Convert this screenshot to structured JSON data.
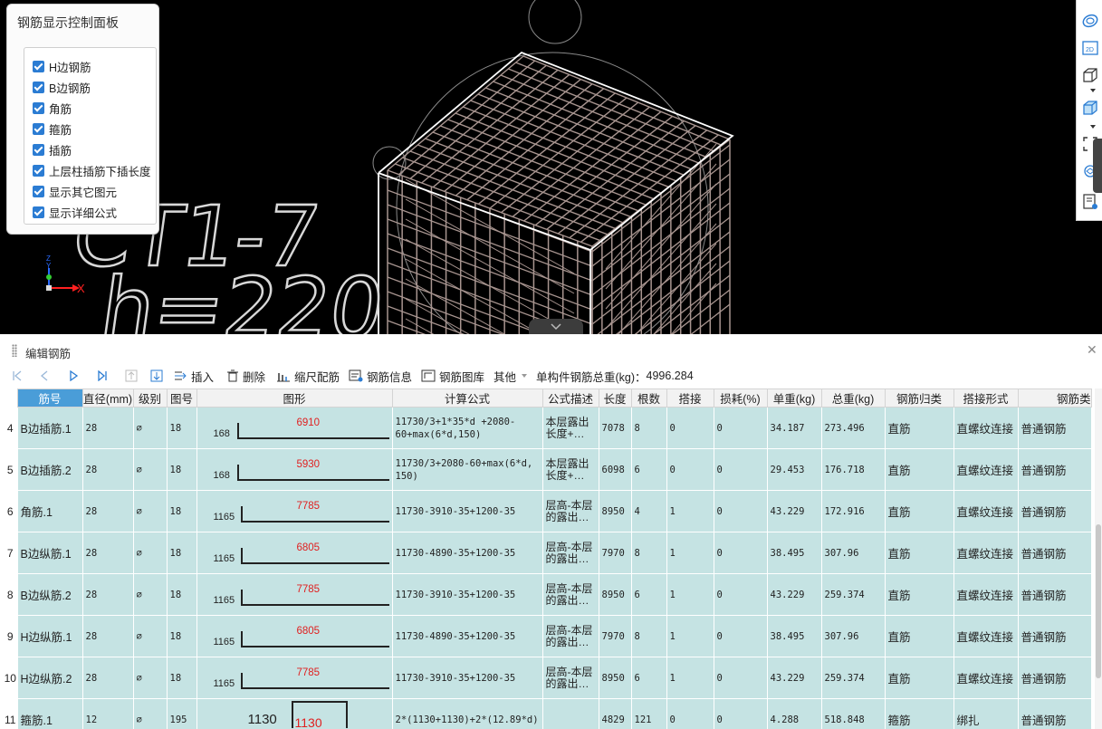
{
  "viewport": {
    "annotation_line1": "CT1-7",
    "annotation_line2": "h=220",
    "axis_x": "X",
    "axis_y": "Y",
    "axis_z": "Z"
  },
  "control_panel": {
    "title": "钢筋显示控制面板",
    "options": [
      {
        "label": "H边钢筋",
        "checked": true
      },
      {
        "label": "B边钢筋",
        "checked": true
      },
      {
        "label": "角筋",
        "checked": true
      },
      {
        "label": "箍筋",
        "checked": true
      },
      {
        "label": "插筋",
        "checked": true
      },
      {
        "label": "上层柱插筋下插长度",
        "checked": true
      },
      {
        "label": "显示其它图元",
        "checked": true
      },
      {
        "label": "显示详细公式",
        "checked": true
      }
    ]
  },
  "right_toolbar": {
    "icons": [
      "orbit-icon",
      "view-2d-icon",
      "box-wireframe-icon",
      "box-solid-icon",
      "zoom-extent-icon",
      "rotate-view-icon",
      "property-list-icon"
    ],
    "view_2d_label": "2D"
  },
  "editor": {
    "title": "编辑钢筋",
    "toolbar": {
      "insert": "插入",
      "delete": "删除",
      "scale_rebar": "缩尺配筋",
      "rebar_info": "钢筋信息",
      "rebar_library": "钢筋图库",
      "other": "其他",
      "total_weight_label": "单构件钢筋总重(kg)：",
      "total_weight_value": "4996.284"
    },
    "columns": [
      "筋号",
      "直径(mm)",
      "级别",
      "图号",
      "图形",
      "计算公式",
      "公式描述",
      "长度",
      "根数",
      "搭接",
      "损耗(%)",
      "单重(kg)",
      "总重(kg)",
      "钢筋归类",
      "搭接形式",
      "钢筋类"
    ],
    "grade_symbol": "⌀",
    "rows": [
      {
        "no": "4",
        "name": "B边插筋.1",
        "dia": "28",
        "fig": "18",
        "left": "168",
        "len_label": "6910",
        "formula": "11730/3+1*35*d +2080-60+max(6*d,150)",
        "desc": "本层露出长度+…",
        "length": "7078",
        "count": "8",
        "lap": "0",
        "loss": "0",
        "unit_w": "34.187",
        "total_w": "273.496",
        "category": "直筋",
        "lap_type": "直螺纹连接",
        "type": "普通钢筋"
      },
      {
        "no": "5",
        "name": "B边插筋.2",
        "dia": "28",
        "fig": "18",
        "left": "168",
        "len_label": "5930",
        "formula": "11730/3+2080-60+max(6*d, 150)",
        "desc": "本层露出长度+…",
        "length": "6098",
        "count": "6",
        "lap": "0",
        "loss": "0",
        "unit_w": "29.453",
        "total_w": "176.718",
        "category": "直筋",
        "lap_type": "直螺纹连接",
        "type": "普通钢筋"
      },
      {
        "no": "6",
        "name": "角筋.1",
        "dia": "28",
        "fig": "18",
        "left": "1165",
        "len_label": "7785",
        "formula": "11730-3910-35+1200-35",
        "desc": "层高-本层的露出…",
        "length": "8950",
        "count": "4",
        "lap": "1",
        "loss": "0",
        "unit_w": "43.229",
        "total_w": "172.916",
        "category": "直筋",
        "lap_type": "直螺纹连接",
        "type": "普通钢筋"
      },
      {
        "no": "7",
        "name": "B边纵筋.1",
        "dia": "28",
        "fig": "18",
        "left": "1165",
        "len_label": "6805",
        "formula": "11730-4890-35+1200-35",
        "desc": "层高-本层的露出…",
        "length": "7970",
        "count": "8",
        "lap": "1",
        "loss": "0",
        "unit_w": "38.495",
        "total_w": "307.96",
        "category": "直筋",
        "lap_type": "直螺纹连接",
        "type": "普通钢筋"
      },
      {
        "no": "8",
        "name": "B边纵筋.2",
        "dia": "28",
        "fig": "18",
        "left": "1165",
        "len_label": "7785",
        "formula": "11730-3910-35+1200-35",
        "desc": "层高-本层的露出…",
        "length": "8950",
        "count": "6",
        "lap": "1",
        "loss": "0",
        "unit_w": "43.229",
        "total_w": "259.374",
        "category": "直筋",
        "lap_type": "直螺纹连接",
        "type": "普通钢筋"
      },
      {
        "no": "9",
        "name": "H边纵筋.1",
        "dia": "28",
        "fig": "18",
        "left": "1165",
        "len_label": "6805",
        "formula": "11730-4890-35+1200-35",
        "desc": "层高-本层的露出…",
        "length": "7970",
        "count": "8",
        "lap": "1",
        "loss": "0",
        "unit_w": "38.495",
        "total_w": "307.96",
        "category": "直筋",
        "lap_type": "直螺纹连接",
        "type": "普通钢筋"
      },
      {
        "no": "10",
        "name": "H边纵筋.2",
        "dia": "28",
        "fig": "18",
        "left": "1165",
        "len_label": "7785",
        "formula": "11730-3910-35+1200-35",
        "desc": "层高-本层的露出…",
        "length": "8950",
        "count": "6",
        "lap": "1",
        "loss": "0",
        "unit_w": "43.229",
        "total_w": "259.374",
        "category": "直筋",
        "lap_type": "直螺纹连接",
        "type": "普通钢筋"
      },
      {
        "no": "11",
        "name": "箍筋.1",
        "dia": "12",
        "fig": "195",
        "left": "1130",
        "len_label": "1130",
        "formula": "2*(1130+1130)+2*(12.89*d)",
        "desc": "",
        "length": "4829",
        "count": "121",
        "lap": "0",
        "loss": "0",
        "unit_w": "4.288",
        "total_w": "518.848",
        "category": "箍筋",
        "lap_type": "绑扎",
        "type": "普通钢筋"
      }
    ]
  }
}
